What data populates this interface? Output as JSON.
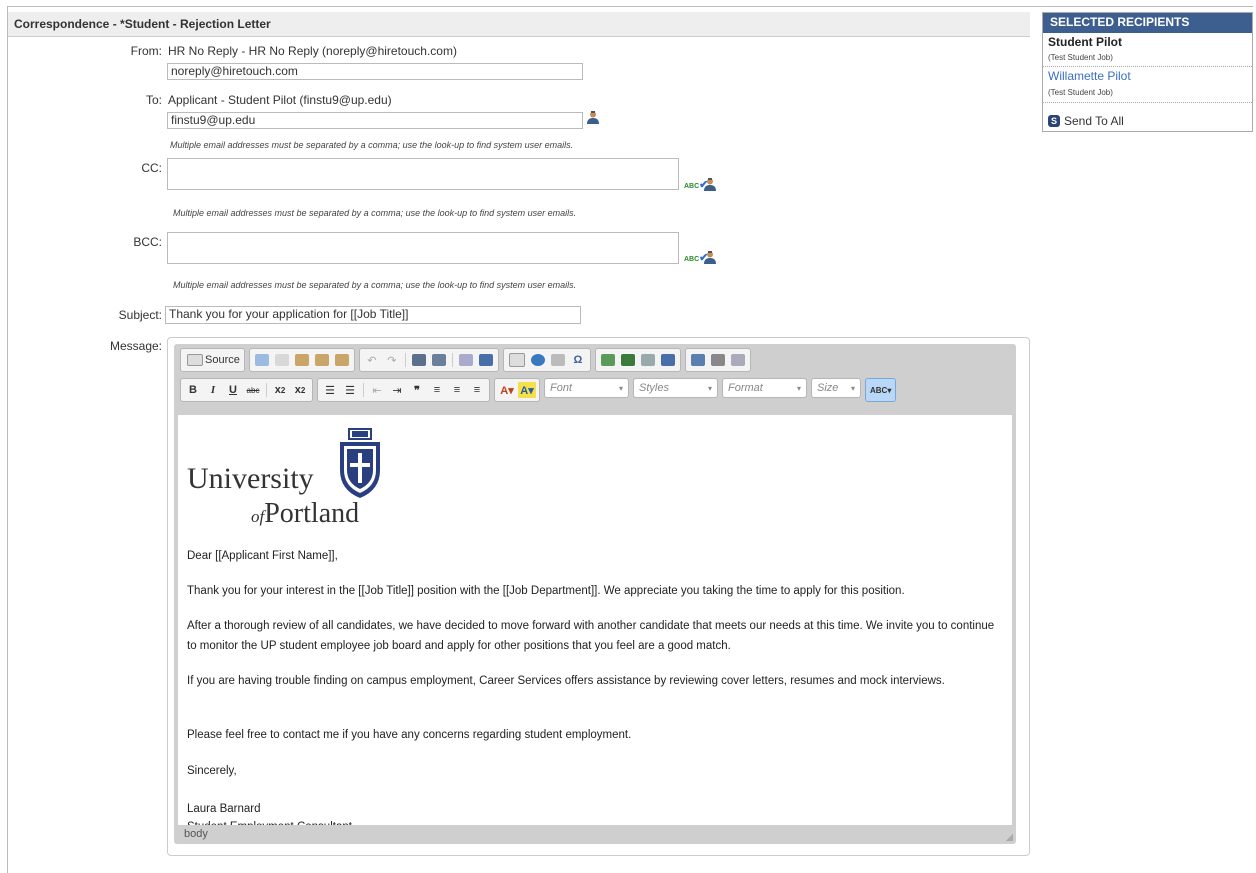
{
  "header": {
    "title": "Correspondence - *Student - Rejection Letter"
  },
  "form": {
    "from": {
      "label": "From:",
      "display": "HR No Reply - HR No Reply (noreply@hiretouch.com)",
      "value": "noreply@hiretouch.com"
    },
    "to": {
      "label": "To:",
      "display": "Applicant - Student Pilot (finstu9@up.edu)",
      "value": "finstu9@up.edu"
    },
    "hint": "Multiple email addresses must be separated by a comma; use the look-up to find system user emails.",
    "cc": {
      "label": "CC:",
      "value": ""
    },
    "bcc": {
      "label": "BCC:",
      "value": ""
    },
    "subject": {
      "label": "Subject:",
      "value": "Thank you for your application for [[Job Title]]"
    },
    "message": {
      "label": "Message:"
    }
  },
  "editor": {
    "source_label": "Source",
    "combos": {
      "font": "Font",
      "styles": "Styles",
      "format": "Format",
      "size": "Size"
    },
    "path": "body",
    "logo": {
      "line1": "University",
      "line2_small": "of",
      "line2": "Portland"
    },
    "body": [
      "Dear [[Applicant First Name]],",
      "Thank you for your interest in the [[Job Title]] position with the [[Job Department]]. We appreciate you taking the time to apply for this position.",
      "After a thorough review of all candidates, we have decided to move forward with another candidate that meets our needs at this time. We invite you to continue to monitor the UP student employee job board and apply for other positions that you feel are a good match.",
      "If you are having trouble finding on campus employment, Career Services offers assistance by reviewing cover letters, resumes and mock interviews.",
      "Please feel free to contact me if you have any concerns regarding student employment.",
      "Sincerely,",
      "Laura Barnard",
      "Student Employment Consultant"
    ]
  },
  "sidebar": {
    "title": "SELECTED RECIPIENTS",
    "recipients": [
      {
        "name": "Student Pilot",
        "job": "(Test Student Job)"
      },
      {
        "name": "Willamette Pilot",
        "job": "(Test Student Job)"
      }
    ],
    "send_all": "Send To All"
  },
  "colors": {
    "accent": "#3d5f8f",
    "link": "#3a6fc4"
  }
}
